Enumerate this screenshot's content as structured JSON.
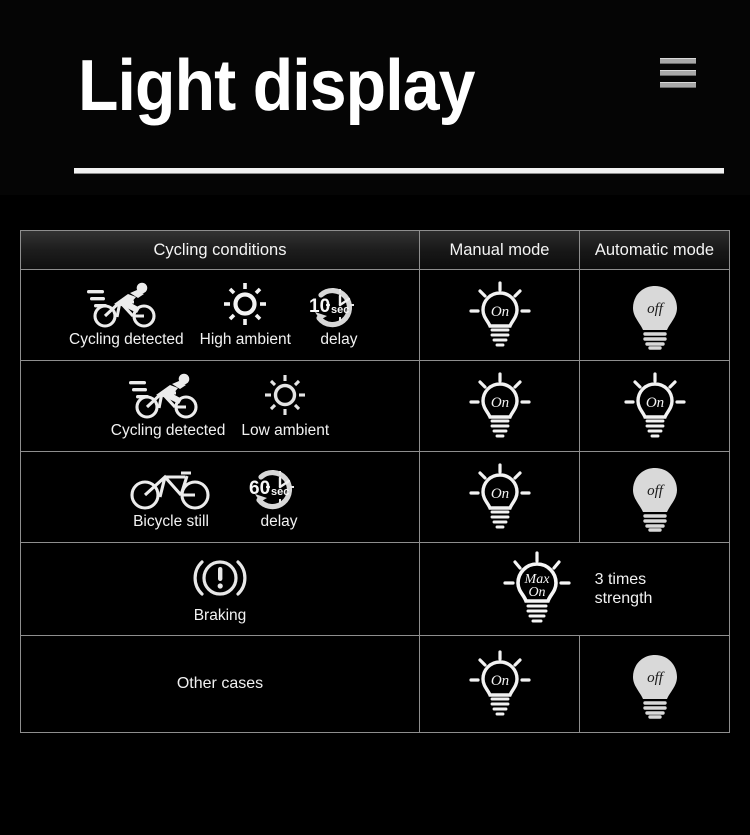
{
  "header": {
    "title": "Light display",
    "menu_icon": "hamburger-menu-icon"
  },
  "table": {
    "columns": [
      {
        "key": "conditions",
        "label": "Cycling conditions"
      },
      {
        "key": "manual",
        "label": "Manual mode"
      },
      {
        "key": "automatic",
        "label": "Automatic mode"
      }
    ],
    "rows": [
      {
        "id": "row-high-ambient",
        "conditions": [
          {
            "icon": "cyclist-moving-icon",
            "label": "Cycling detected"
          },
          {
            "icon": "sun-bright-icon",
            "label": "High ambient"
          },
          {
            "icon": "clock-delay-icon",
            "label": "delay",
            "value": "10",
            "unit": "sec"
          }
        ],
        "manual": {
          "state": "On",
          "icon": "bulb-on-icon"
        },
        "automatic": {
          "state": "off",
          "icon": "bulb-off-icon"
        }
      },
      {
        "id": "row-low-ambient",
        "conditions": [
          {
            "icon": "cyclist-moving-icon",
            "label": "Cycling detected"
          },
          {
            "icon": "sun-dim-icon",
            "label": "Low ambient"
          }
        ],
        "manual": {
          "state": "On",
          "icon": "bulb-on-icon"
        },
        "automatic": {
          "state": "On",
          "icon": "bulb-on-icon"
        }
      },
      {
        "id": "row-bicycle-still",
        "conditions": [
          {
            "icon": "bicycle-icon",
            "label": "Bicycle still"
          },
          {
            "icon": "clock-delay-icon",
            "label": "delay",
            "value": "60",
            "unit": "sec"
          }
        ],
        "manual": {
          "state": "On",
          "icon": "bulb-on-icon"
        },
        "automatic": {
          "state": "off",
          "icon": "bulb-off-icon"
        }
      },
      {
        "id": "row-braking",
        "conditions": [
          {
            "icon": "brake-warning-icon",
            "label": "Braking"
          }
        ],
        "merged": {
          "state": "Max On",
          "state_line1": "Max",
          "state_line2": "On",
          "icon": "bulb-max-on-icon",
          "note": "3 times\nstrength"
        }
      },
      {
        "id": "row-other-cases",
        "conditions_text": "Other cases",
        "manual": {
          "state": "On",
          "icon": "bulb-on-icon"
        },
        "automatic": {
          "state": "off",
          "icon": "bulb-off-icon"
        }
      }
    ]
  },
  "colors": {
    "background": "#000000",
    "text": "#ffffff",
    "border": "#8e8e8e",
    "bulb_off_fill": "#d9d9d9",
    "icon": "#e8e8e8"
  }
}
